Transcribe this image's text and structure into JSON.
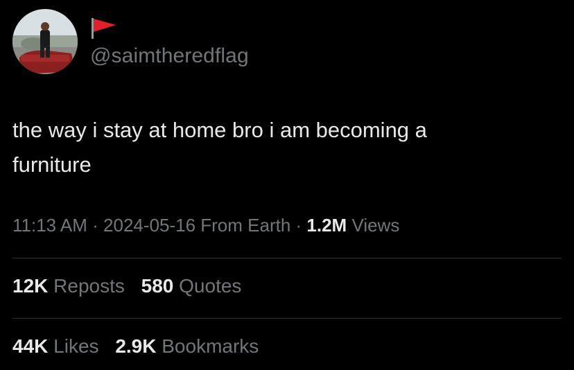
{
  "author": {
    "handle": "@saimtheredflag",
    "flag_icon": "red-flag-icon",
    "flag_color": "#e0202a"
  },
  "tweet": {
    "text_line1": "the way i stay at home bro i am becoming a",
    "text_line2": "furniture"
  },
  "meta": {
    "time": "11:13 AM",
    "sep1": " · ",
    "date": "2024-05-16",
    "source": " From Earth",
    "sep2": " · ",
    "views_count": "1.2M",
    "views_label": " Views"
  },
  "stats": {
    "reposts_count": "12K",
    "reposts_label": " Reposts",
    "quotes_count": "580",
    "quotes_label": " Quotes",
    "likes_count": "44K",
    "likes_label": " Likes",
    "bookmarks_count": "2.9K",
    "bookmarks_label": " Bookmarks"
  },
  "colors": {
    "background": "#000000",
    "text": "#e7e9ea",
    "secondary": "#71767b",
    "divider": "#2f3336"
  }
}
